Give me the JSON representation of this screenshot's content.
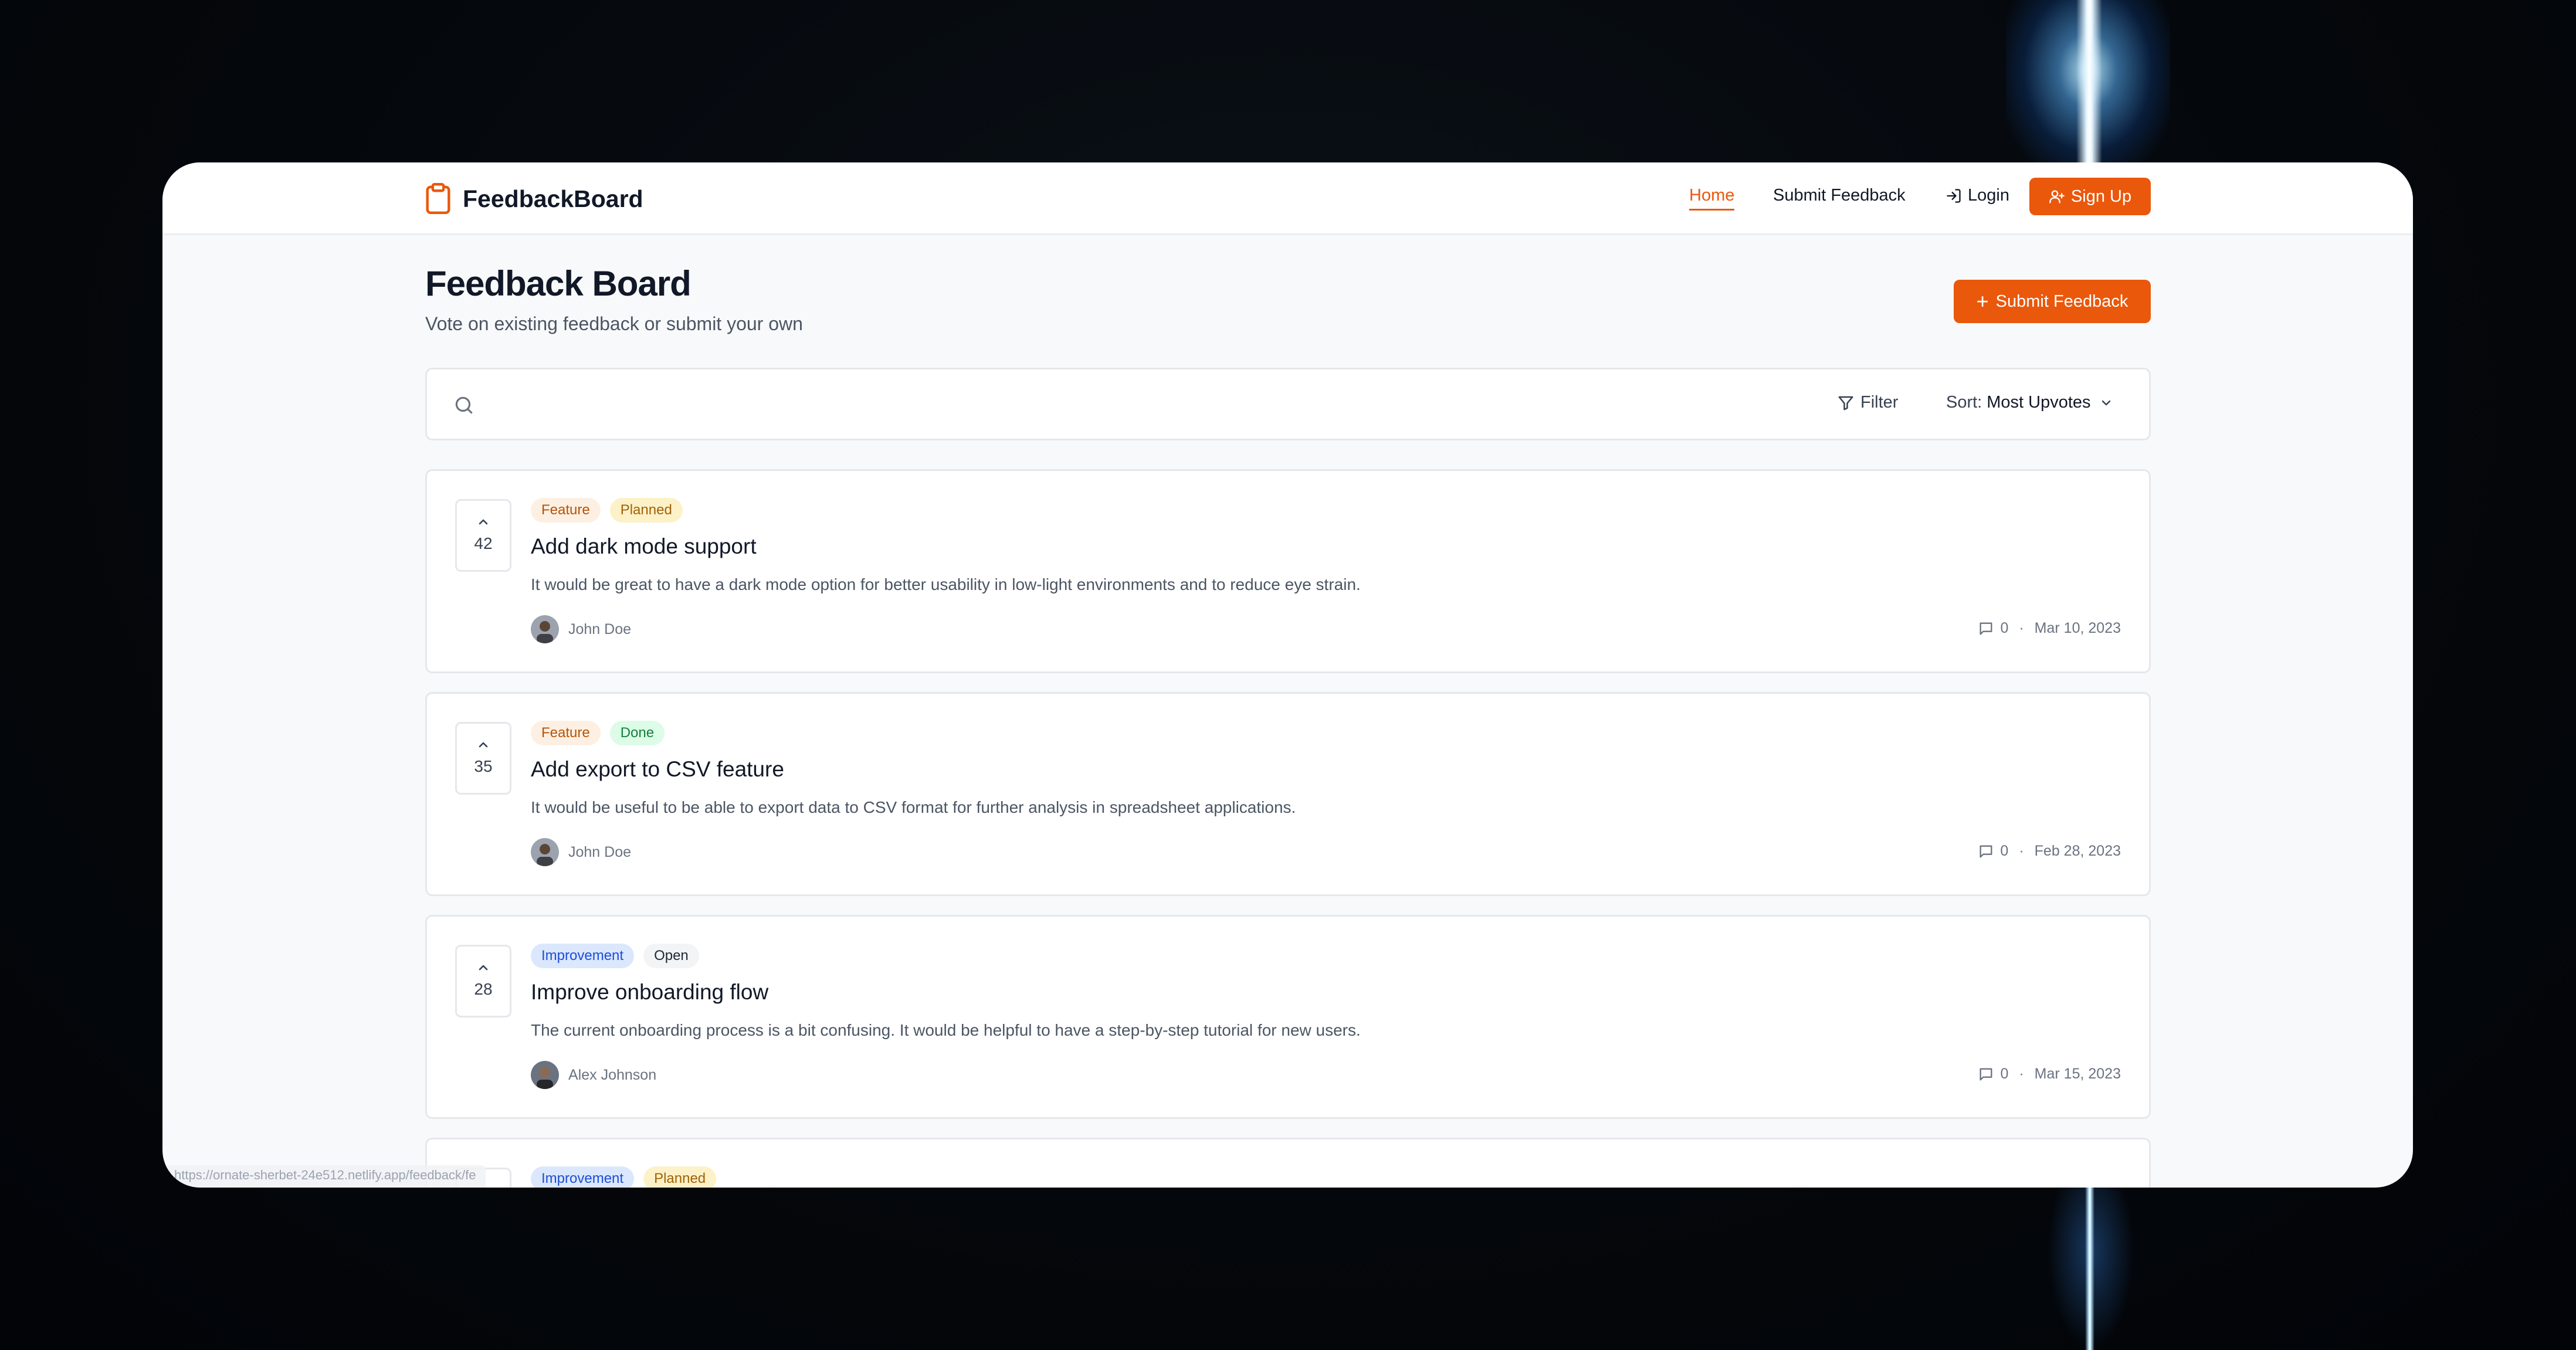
{
  "app": {
    "brand": "FeedbackBoard",
    "brand_icon": "clipboard-icon",
    "accent_color": "#ea580c"
  },
  "nav": {
    "home": "Home",
    "submit_feedback": "Submit Feedback",
    "login": "Login",
    "signup": "Sign Up"
  },
  "header": {
    "title": "Feedback Board",
    "subtitle": "Vote on existing feedback or submit your own",
    "submit_button": "Submit Feedback"
  },
  "toolbar": {
    "search_placeholder": "",
    "filter_label": "Filter",
    "sort_label": "Sort:",
    "sort_value": "Most Upvotes"
  },
  "feedback": [
    {
      "votes": "42",
      "tags": [
        "Feature",
        "Planned"
      ],
      "title": "Add dark mode support",
      "description": "It would be great to have a dark mode option for better usability in low-light environments and to reduce eye strain.",
      "author": "John Doe",
      "comments": "0",
      "date": "Mar 10, 2023"
    },
    {
      "votes": "35",
      "tags": [
        "Feature",
        "Done"
      ],
      "title": "Add export to CSV feature",
      "description": "It would be useful to be able to export data to CSV format for further analysis in spreadsheet applications.",
      "author": "John Doe",
      "comments": "0",
      "date": "Feb 28, 2023"
    },
    {
      "votes": "28",
      "tags": [
        "Improvement",
        "Open"
      ],
      "title": "Improve onboarding flow",
      "description": "The current onboarding process is a bit confusing. It would be helpful to have a step-by-step tutorial for new users.",
      "author": "Alex Johnson",
      "comments": "0",
      "date": "Mar 15, 2023"
    },
    {
      "tags": [
        "Improvement",
        "Planned"
      ]
    }
  ],
  "status_bar": {
    "url": "https://ornate-sherbet-24e512.netlify.app/feedback/fe"
  }
}
